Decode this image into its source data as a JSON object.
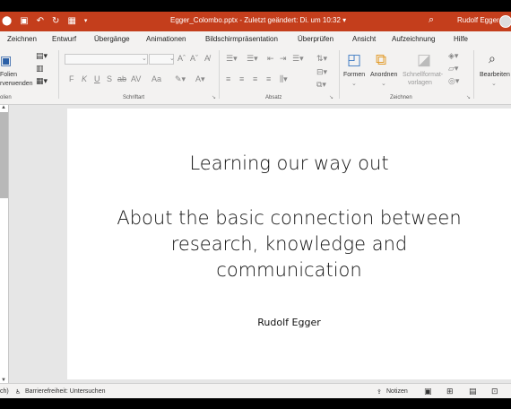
{
  "title_bar": {
    "filename": "Egger_Colombo.pptx",
    "saved_status": "Zuletzt geändert: Di. um 10:32",
    "user": "Rudolf Egger",
    "colors": {
      "accent": "#c43e1c"
    }
  },
  "tabs": [
    "Zeichnen",
    "Entwurf",
    "Übergänge",
    "Animationen",
    "Bildschirmpräsentation",
    "Überprüfen",
    "Ansicht",
    "Aufzeichnung",
    "Hilfe"
  ],
  "ribbon": {
    "folien": {
      "line1": "Folien",
      "line2": "rverwenden",
      "label": "olien"
    },
    "schriftart": {
      "label": "Schriftart",
      "format_buttons": [
        "F",
        "K",
        "U",
        "S",
        "ab",
        "AV",
        "Aa"
      ]
    },
    "absatz": {
      "label": "Absatz"
    },
    "zeichnen": {
      "label": "Zeichnen",
      "formen": "Formen",
      "anordnen": "Anordnen",
      "schnellformat1": "Schnellformat-",
      "schnellformat2": "vorlagen"
    },
    "bearbeiten": {
      "label": "Bearbeiten"
    }
  },
  "slide": {
    "title": "Learning our way out",
    "subtitle_lines": [
      "About the basic connection between",
      "research, knowledge and",
      "communication"
    ],
    "author": "Rudolf Egger"
  },
  "status_bar": {
    "lang_fragment": "ch)",
    "accessibility": "Barrierefreiheit: Untersuchen",
    "notes": "Notizen"
  }
}
